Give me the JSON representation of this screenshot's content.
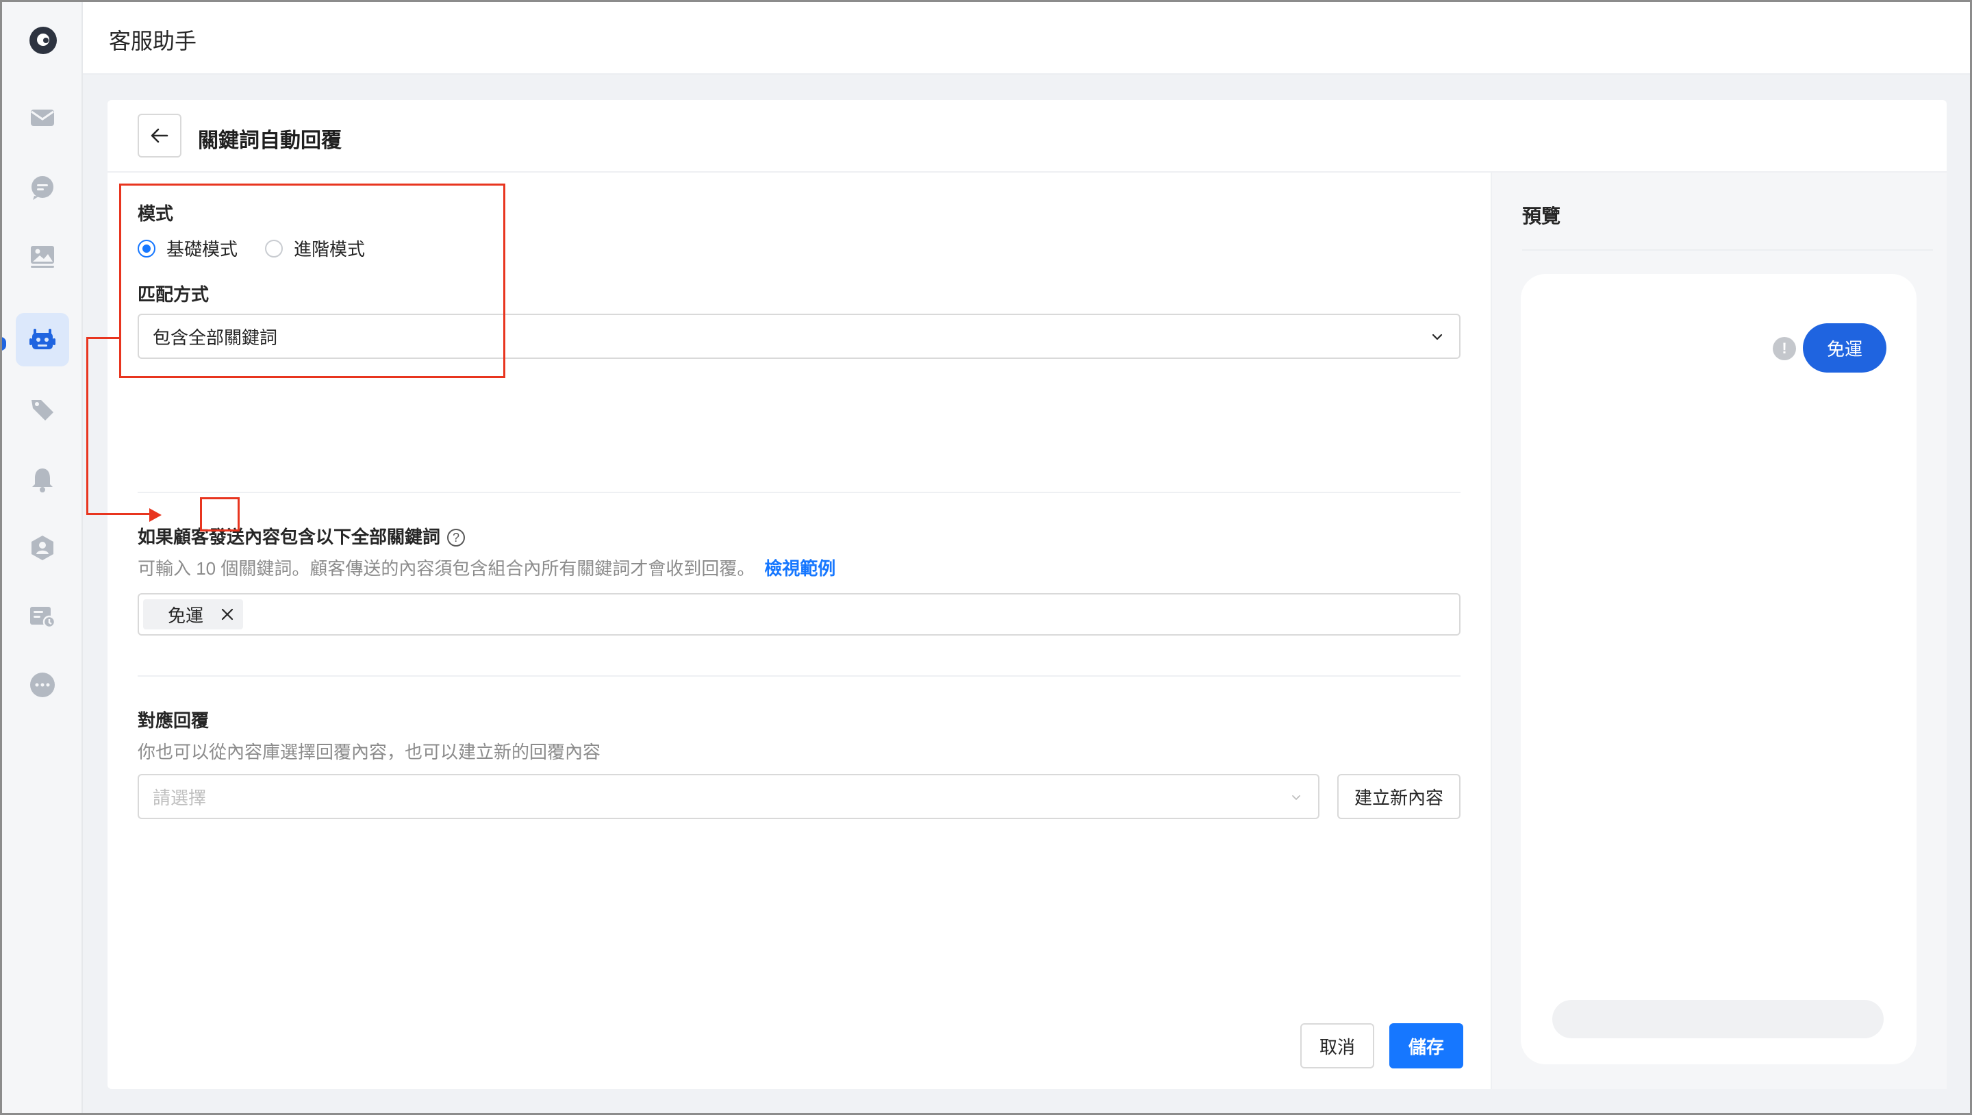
{
  "app": {
    "title": "客服助手"
  },
  "sidebar": {
    "items": [
      {
        "name": "inbox",
        "icon": "envelope-icon"
      },
      {
        "name": "chat",
        "icon": "chat-bubble-icon"
      },
      {
        "name": "media",
        "icon": "image-icon"
      },
      {
        "name": "bot",
        "icon": "robot-icon",
        "active": true
      },
      {
        "name": "tags",
        "icon": "tag-icon"
      },
      {
        "name": "notifications",
        "icon": "bell-icon"
      },
      {
        "name": "contacts",
        "icon": "user-hexagon-icon"
      },
      {
        "name": "broadcast",
        "icon": "message-card-icon"
      },
      {
        "name": "more",
        "icon": "more-dots-icon"
      }
    ]
  },
  "page": {
    "title": "關鍵詞自動回覆",
    "back_icon": "arrow-left-icon"
  },
  "form": {
    "mode": {
      "label": "模式",
      "options": [
        {
          "label": "基礎模式",
          "checked": true
        },
        {
          "label": "進階模式",
          "checked": false
        }
      ]
    },
    "match": {
      "label": "匹配方式",
      "value": "包含全部關鍵詞"
    },
    "keywords": {
      "label": "如果顧客發送內容包含以下全部關鍵詞",
      "help": "?",
      "description": "可輸入 10 個關鍵詞。顧客傳送的內容須包含組合內所有關鍵詞才會收到回覆。",
      "link": "檢視範例",
      "tags": [
        "免運"
      ]
    },
    "reply": {
      "label": "對應回覆",
      "description": "你也可以從內容庫選擇回覆內容，也可以建立新的回覆內容",
      "placeholder": "請選擇",
      "create_button": "建立新內容"
    },
    "actions": {
      "cancel": "取消",
      "save": "儲存"
    }
  },
  "preview": {
    "title": "預覽",
    "message": "免運",
    "warning": "!"
  },
  "colors": {
    "accent": "#1677ff",
    "bubble": "#1f64e0",
    "annotation": "#e8351f"
  }
}
